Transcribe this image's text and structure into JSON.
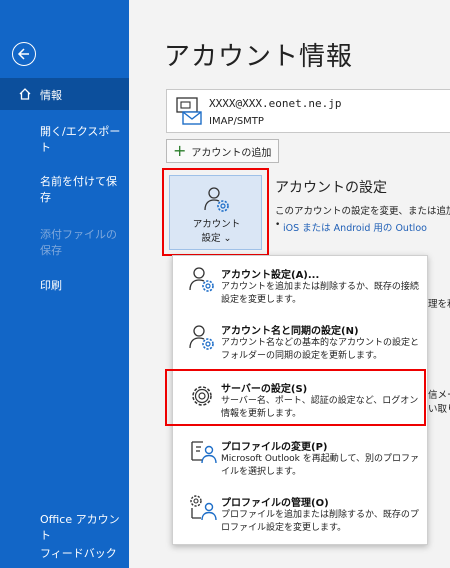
{
  "sidebar": {
    "items": [
      {
        "label": "情報"
      },
      {
        "label": "開く/エクスポート"
      },
      {
        "label": "名前を付けて保存"
      },
      {
        "label": "添付ファイルの保存"
      },
      {
        "label": "印刷"
      },
      {
        "label": "Office アカウント"
      },
      {
        "label": "フィードバック"
      }
    ]
  },
  "main": {
    "title": "アカウント情報",
    "account": {
      "email": "XXXX@XXX.eonet.ne.jp",
      "type": "IMAP/SMTP"
    },
    "add_account_label": "アカウントの追加",
    "settings_button": {
      "line1": "アカウント",
      "line2": "設定 ⌄"
    },
    "section_title": "アカウントの設定",
    "section_desc": "このアカウントの設定を変更、または追加の",
    "section_link": "iOS または Android 用の Outloo",
    "partial_right_1": "理を利",
    "partial_right_2": "信メー",
    "partial_right_3": "い取り"
  },
  "dropdown": {
    "items": [
      {
        "title": "アカウント設定(A)...",
        "desc": "アカウントを追加または削除するか、既存の接続設定を変更します。"
      },
      {
        "title": "アカウント名と同期の設定(N)",
        "desc": "アカウント名などの基本的なアカウントの設定とフォルダーの同期の設定を更新します。"
      },
      {
        "title": "サーバーの設定(S)",
        "desc": "サーバー名、ポート、認証の設定など、ログオン情報を更新します。"
      },
      {
        "title": "プロファイルの変更(P)",
        "desc": "Microsoft Outlook を再起動して、別のプロファイルを選択します。"
      },
      {
        "title": "プロファイルの管理(O)",
        "desc": "プロファイルを追加または削除するか、既存のプロファイル設定を変更します。"
      }
    ]
  }
}
